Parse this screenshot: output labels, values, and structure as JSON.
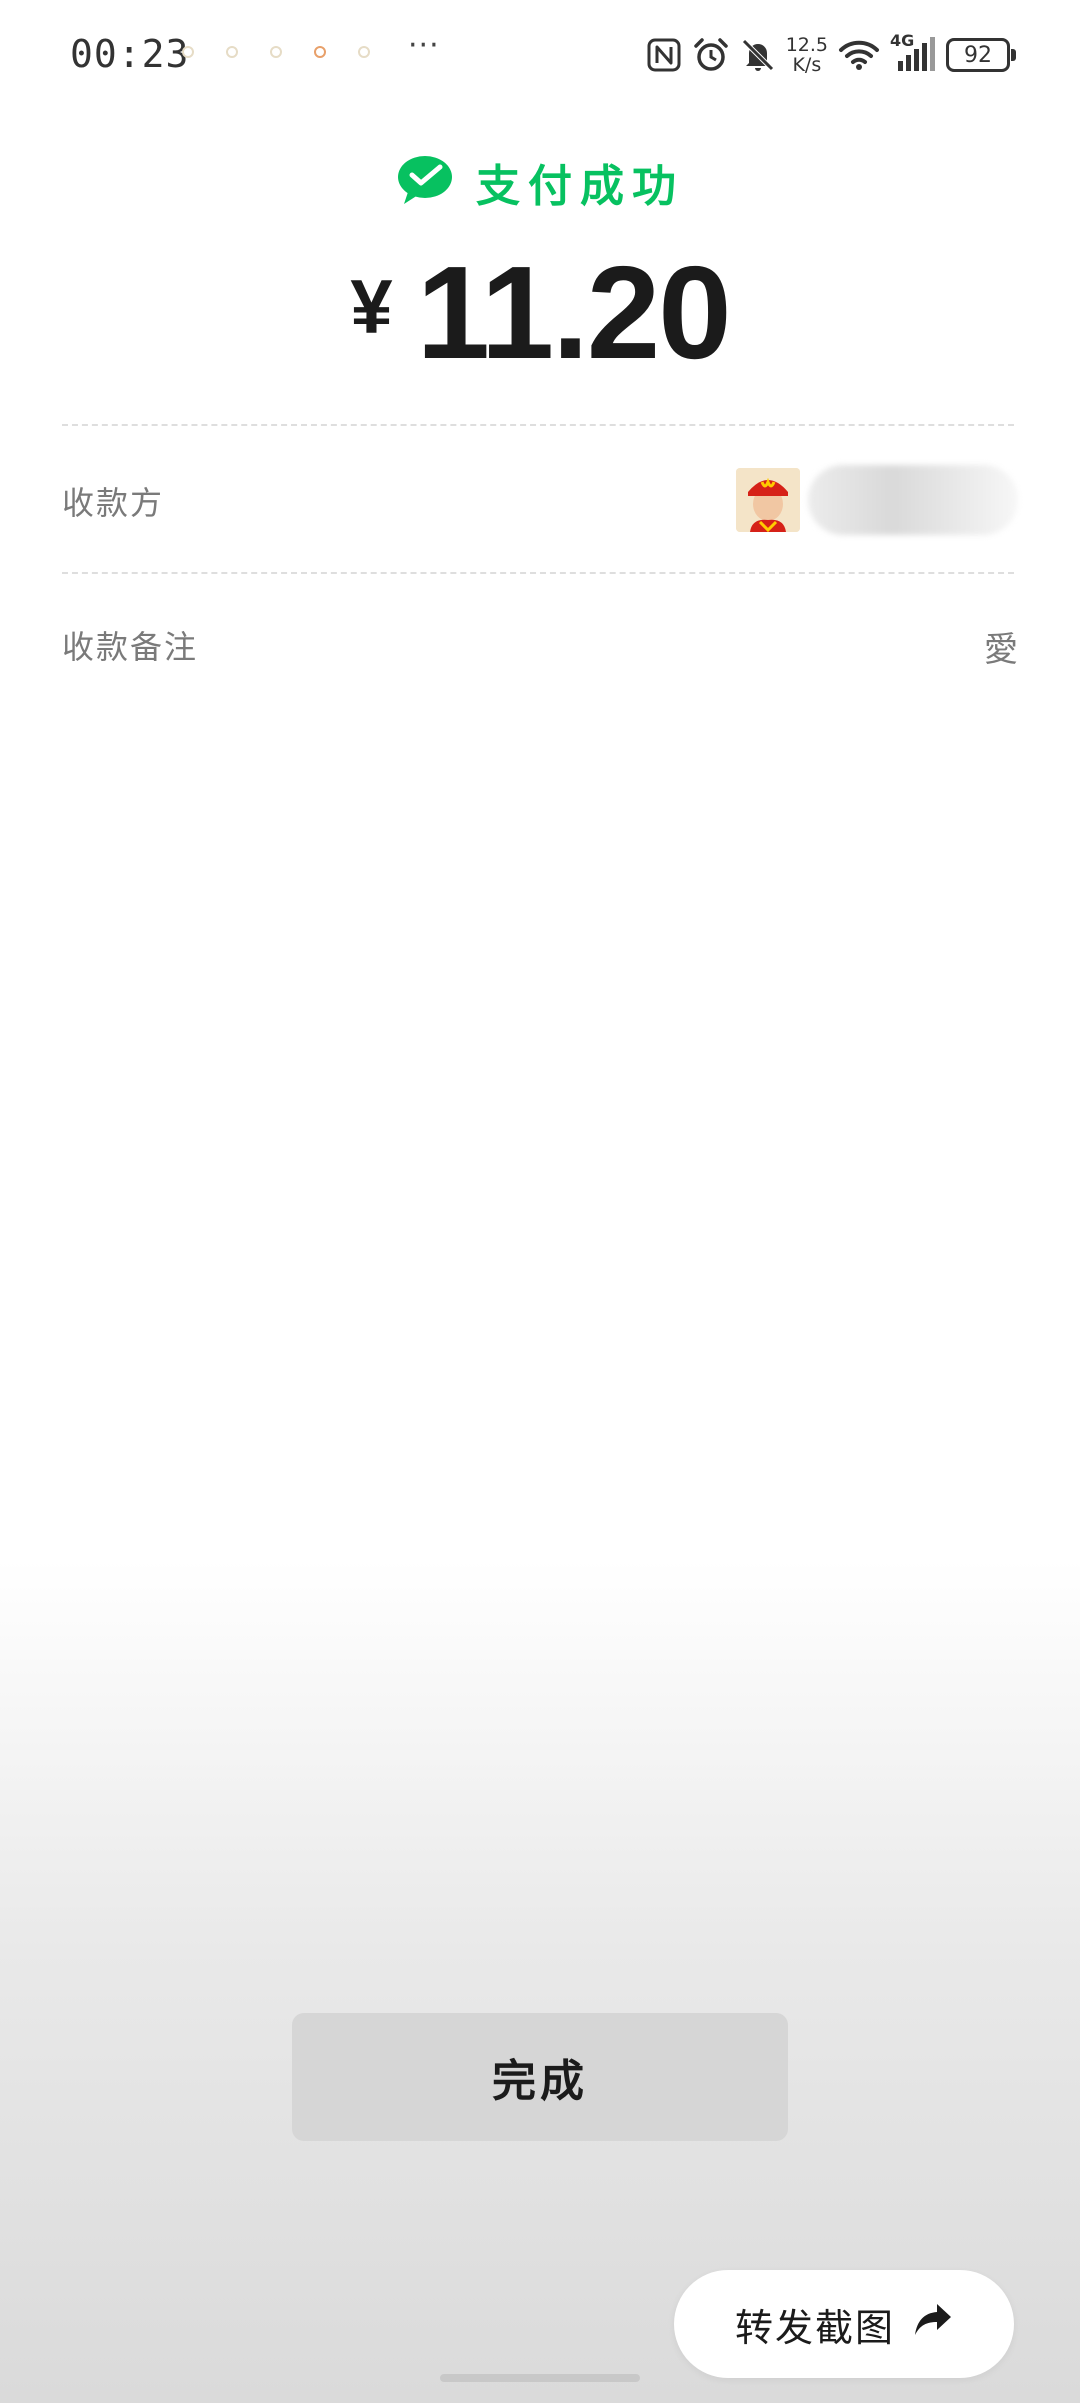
{
  "status_bar": {
    "time": "00:23",
    "more": "···",
    "net_speed_value": "12.5",
    "net_speed_unit": "K/s",
    "network_type": "4G",
    "battery_level": "92"
  },
  "header": {
    "title": "支付成功",
    "currency_symbol": "¥",
    "amount": "11.20"
  },
  "details": {
    "payee_label": "收款方",
    "note_label": "收款备注",
    "note_value": "愛"
  },
  "buttons": {
    "done_label": "完成",
    "share_label": "转发截图"
  },
  "colors": {
    "accent_green": "#07c160",
    "done_button_bg": "#d6d6d6"
  },
  "icons": {
    "title_icon": "wechat-pay-icon",
    "share_icon": "share-arrow-icon",
    "nfc_icon": "nfc-icon",
    "alarm_icon": "alarm-icon",
    "mute_icon": "bell-off-icon",
    "wifi_icon": "wifi-icon",
    "signal_icon": "signal-icon",
    "battery_icon": "battery-icon"
  }
}
